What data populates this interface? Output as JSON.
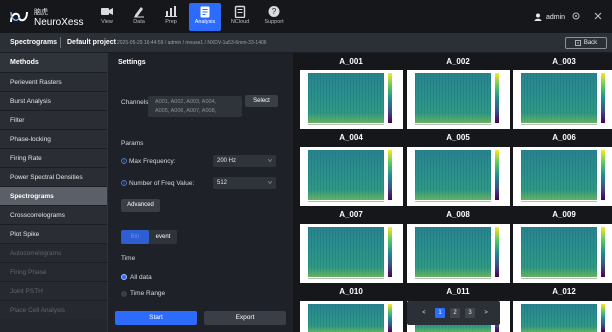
{
  "brand": {
    "name_cn": "脑虎",
    "name_en": "NeuroXess"
  },
  "nav": [
    {
      "label": "View",
      "icon": "video-camera-icon"
    },
    {
      "label": "Data",
      "icon": "pencil-doc-icon"
    },
    {
      "label": "Prep",
      "icon": "bar-chart-icon"
    },
    {
      "label": "Analysis",
      "icon": "clipboard-icon",
      "active": true
    },
    {
      "label": "NCloud",
      "icon": "cloud-doc-icon"
    },
    {
      "label": "Support",
      "icon": "help-icon"
    }
  ],
  "user": {
    "name": "admin"
  },
  "breadcrumb": {
    "title": "Spectrograms",
    "project": "Default project",
    "meta": "2025-05-29 16:44:59 / admin / mouse1 / NXDV-1a53-6mm-33-1406",
    "back_label": "Back"
  },
  "methods": {
    "header": "Methods",
    "items": [
      {
        "label": "Perievent Rasters",
        "state": "normal"
      },
      {
        "label": "Burst Analysis",
        "state": "normal"
      },
      {
        "label": "Filter",
        "state": "normal"
      },
      {
        "label": "Phase-locking",
        "state": "normal"
      },
      {
        "label": "Firing Rate",
        "state": "normal"
      },
      {
        "label": "Power Spectral Densities",
        "state": "normal"
      },
      {
        "label": "Spectrograms",
        "state": "active"
      },
      {
        "label": "Crosscorrelograms",
        "state": "normal"
      },
      {
        "label": "Plot Spike",
        "state": "normal"
      },
      {
        "label": "Autocorrelograms",
        "state": "disabled"
      },
      {
        "label": "Firing Phase",
        "state": "disabled"
      },
      {
        "label": "Joint PSTH",
        "state": "disabled"
      },
      {
        "label": "Place Cell Analysis",
        "state": "disabled"
      }
    ]
  },
  "settings": {
    "header": "Settings",
    "channels_label": "Channels:",
    "channels_line1": "A001, A002, A003, A004,",
    "channels_line2": "A005, A006, A007, A008,",
    "select_label": "Select",
    "params_label": "Params",
    "max_freq_label": "Max Frequency:",
    "max_freq_value": "200 Hz",
    "num_freq_label": "Number of Freq Value:",
    "num_freq_value": "512",
    "advanced_label": "Advanced",
    "toggle_left": "Bin",
    "toggle_right": "event",
    "time_label": "Time",
    "time_all": "All data",
    "time_range": "Time Range",
    "start_label": "Start",
    "export_label": "Export"
  },
  "grid": {
    "cells": [
      "A_001",
      "A_002",
      "A_003",
      "A_004",
      "A_005",
      "A_006",
      "A_007",
      "A_008",
      "A_009",
      "A_010",
      "A_011",
      "A_012"
    ],
    "colormap": [
      "#fde725",
      "#5ec962",
      "#21918c",
      "#3b528b",
      "#440154"
    ]
  },
  "pager": {
    "pages": [
      "1",
      "2",
      "3"
    ],
    "current": "1",
    "prev": "<",
    "next": ">"
  }
}
